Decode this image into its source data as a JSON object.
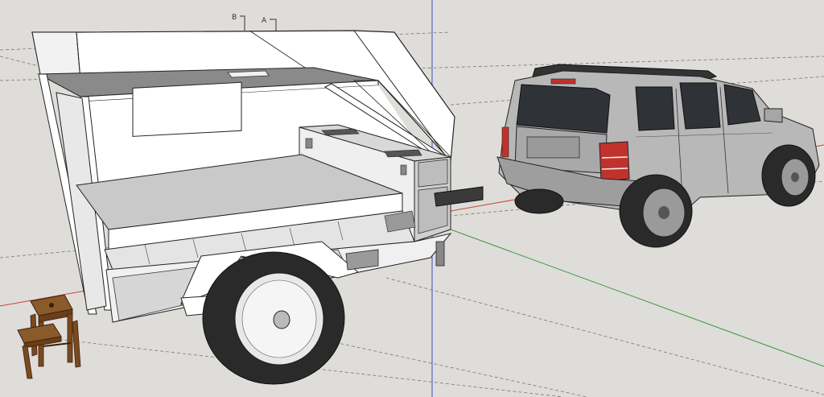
{
  "viewport": {
    "background": "#dfddd9",
    "axis_colors": {
      "red": "#c8443a",
      "green": "#3e9a3a",
      "blue": "#3b4fc8"
    }
  },
  "section_marks": {
    "b": "B",
    "a": "A"
  },
  "model": {
    "objects": [
      "camper-trailer",
      "suv",
      "step-stool"
    ],
    "trailer_frame_color": "#ffffff",
    "trailer_floor_color": "#c9c9c9",
    "trailer_roof_color": "#8a8a8a",
    "suv_body_color": "#b8b8b8",
    "suv_window_color": "#2f3236",
    "suv_taillight_color": "#c2322c",
    "tire_color": "#2a2a2a",
    "stool_color": "#7a4a1e"
  }
}
